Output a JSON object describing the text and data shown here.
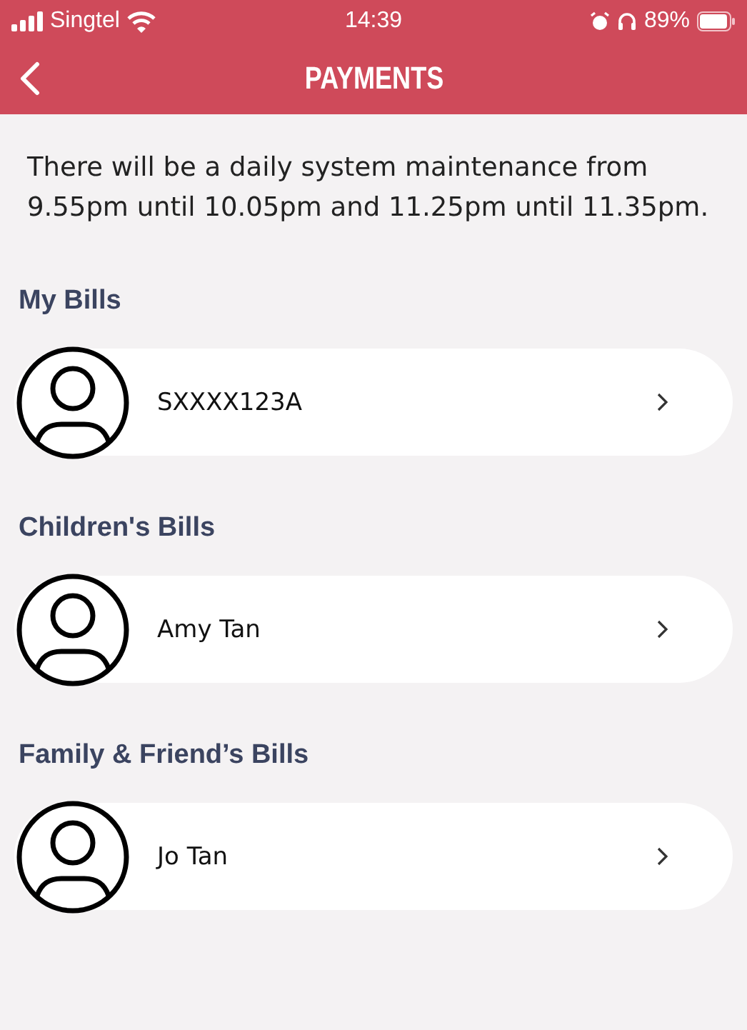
{
  "status_bar": {
    "carrier": "Singtel",
    "time": "14:39",
    "battery": "89%"
  },
  "header": {
    "title": "PAYMENTS"
  },
  "notice": "There will be a daily system maintenance from 9.55pm until 10.05pm and 11.25pm until 11.35pm.",
  "sections": [
    {
      "title": "My Bills",
      "items": [
        {
          "name": "SXXXX123A"
        }
      ]
    },
    {
      "title": "Children's Bills",
      "items": [
        {
          "name": "Amy Tan"
        }
      ]
    },
    {
      "title": "Family & Friend’s Bills",
      "items": [
        {
          "name": "Jo Tan"
        }
      ]
    }
  ]
}
